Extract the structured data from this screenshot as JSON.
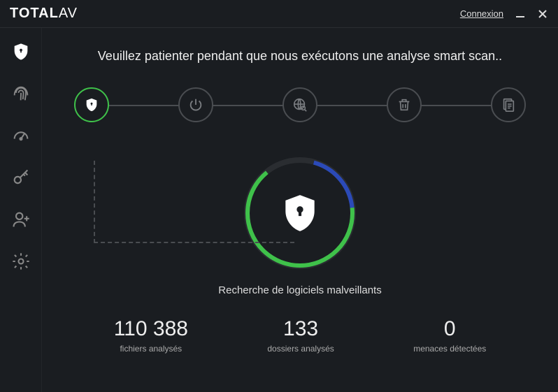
{
  "titlebar": {
    "brand_bold": "TOTAL",
    "brand_thin": "AV",
    "connexion": "Connexion"
  },
  "main": {
    "headline": "Veuillez patienter pendant que nous exécutons une analyse smart scan..",
    "status": "Recherche de logiciels malveillants"
  },
  "stats": {
    "files": {
      "value": "110 388",
      "label": "fichiers analysés"
    },
    "folders": {
      "value": "133",
      "label": "dossiers analysés"
    },
    "threats": {
      "value": "0",
      "label": "menaces détectées"
    }
  },
  "steps": {
    "active_index": 0,
    "icons": [
      "shield",
      "power",
      "globe-search",
      "trash",
      "document"
    ]
  },
  "sidebar": {
    "items": [
      "shield",
      "fingerprint",
      "gauge",
      "key",
      "add-user",
      "settings"
    ],
    "active_index": 0
  },
  "accent_color": "#3fc14a"
}
